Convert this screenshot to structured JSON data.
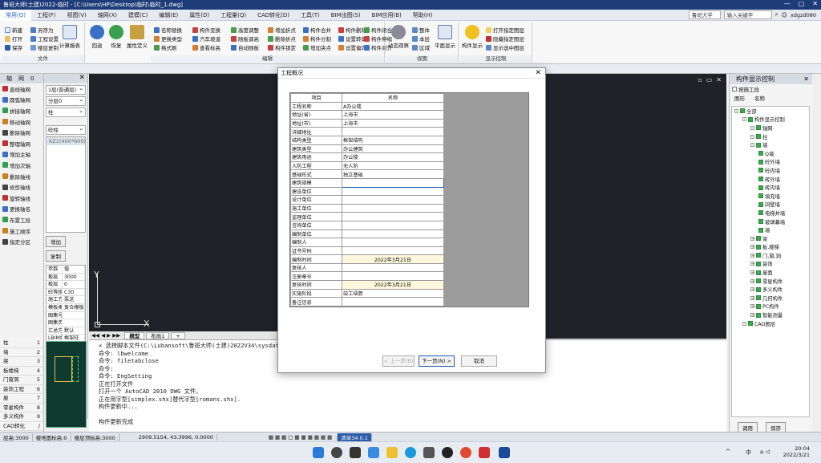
{
  "titlebar": {
    "text": "鲁班大师(土建)2022-临时 - [C:\\Users\\HP\\Desktop\\临时\\临时_1.dwg]"
  },
  "menu": {
    "items": [
      "常用(O)",
      "工程(F)",
      "视图(V)",
      "轴网(X)",
      "建模(C)",
      "编辑(E)",
      "属性(D)",
      "工程量(Q)",
      "CAD转化(D)",
      "工具(T)",
      "BIM出图(S)",
      "BIM应用(B)",
      "帮助(H)"
    ],
    "school": "鲁班大学",
    "search_placeholder": "输入关键字",
    "user": "xdgzd080"
  },
  "ribbon": {
    "file": {
      "title": "文件",
      "items": [
        "新建",
        "另存为",
        "打开",
        "工程设置",
        "保存",
        "楼层复制"
      ],
      "big": "计算报表"
    },
    "undo": [
      "回退",
      "恢复",
      "属性定义"
    ],
    "edit": {
      "title": "编辑",
      "items": [
        "名称替换",
        "构件变换",
        "高度调整",
        "增加折点",
        "构件合并",
        "构件删除",
        "构件闭合",
        "更换类型",
        "汽车坡道",
        "随板调高",
        "删除折点",
        "构件分割",
        "设置转角",
        "构件伸缩",
        "格式刷",
        "查看标高",
        "自动随板",
        "构件锁定",
        "增加夹点",
        "设置偏向",
        "构件对齐"
      ]
    },
    "view": {
      "title": "视图",
      "items": [
        "动态观察",
        "整体",
        "本层",
        "区域",
        "平面显示"
      ]
    },
    "display": {
      "title": "显示控制",
      "items": [
        "打开指定图层",
        "隐藏指定图层",
        "显示选中图层"
      ],
      "big": "构件显示"
    }
  },
  "leftpanel": {
    "header_a": "轴",
    "header_b": "网",
    "header_c": "0",
    "items": [
      "直线轴网",
      "圆弧轴网",
      "拼接轴网",
      "移动轴网",
      "删除轴网",
      "整理轴网",
      "增加主轴",
      "增加次轴",
      "删除轴线",
      "修剪轴线",
      "旋转轴线",
      "更换轴名",
      "布置工段",
      "施工顺序",
      "指定分区"
    ],
    "keys": [
      "0",
      "1",
      "2",
      "3",
      "4",
      "5",
      "6",
      "7",
      "8",
      "9",
      "0",
      "2"
    ]
  },
  "leftpanel2": {
    "floor": "1层(普通层)",
    "section": "分层0",
    "type": "柱",
    "subtype": "砼柱",
    "component": "KZ1(400*600)",
    "add_button": "增加",
    "copy_button": "复制",
    "props": [
      [
        "参数",
        "值"
      ],
      [
        "板层",
        "3000"
      ],
      [
        "板层",
        "0"
      ],
      [
        "砼等级",
        "C30"
      ],
      [
        "施工方式",
        "泵送"
      ],
      [
        "模板类型",
        "复合模板"
      ],
      [
        "图集号",
        ""
      ],
      [
        "图集页",
        ""
      ],
      [
        "汇总方式",
        "默认"
      ],
      [
        "LBIM编码",
        "框架柱"
      ]
    ]
  },
  "navlist": [
    [
      "柱",
      "1"
    ],
    [
      "墙",
      "2"
    ],
    [
      "梁",
      "3"
    ],
    [
      "板楼梯",
      "4"
    ],
    [
      "门窗洞",
      "5"
    ],
    [
      "装饰工程",
      "6"
    ],
    [
      "屋",
      "7"
    ],
    [
      "零星构件",
      "8"
    ],
    [
      "多义构件",
      "9"
    ],
    [
      "CAD转化",
      "/"
    ]
  ],
  "canvas": {
    "ylabel": "Y",
    "xlabel": "X",
    "tabs": [
      "模型",
      "布局1",
      "+"
    ]
  },
  "command": [
    "× 选择脚本文件(C:\\Lubansoft\\鲁班大师(土建)2022V34\\sysdata",
    "命令: lbwelcome",
    "命令: filetabclose",
    "命令:",
    "命令: EngSetting",
    "正在打开文件",
    "打开一个 AutoCAD 2010 DWG 文件。",
    "正在用字型[simplex.shx]替代字型[romans.shx].",
    "构件更新中...",
    "",
    "构件更新完成"
  ],
  "rightpanel": {
    "title": "构件显示控制",
    "checkbox": "按施工段",
    "col1": "图形",
    "col2": "名称",
    "tree": [
      [
        "全部",
        0,
        true
      ],
      [
        "构件显示控制",
        1,
        true
      ],
      [
        "轴网",
        2,
        true
      ],
      [
        "柱",
        2,
        true
      ],
      [
        "墙",
        2,
        true
      ],
      [
        "Q墙",
        3,
        true
      ],
      [
        "砼外墙",
        3,
        true
      ],
      [
        "砼内墙",
        3,
        true
      ],
      [
        "砖外墙",
        3,
        true
      ],
      [
        "砖内墙",
        3,
        true
      ],
      [
        "填充墙",
        3,
        true
      ],
      [
        "间壁墙",
        3,
        true
      ],
      [
        "电梯井墙",
        3,
        true
      ],
      [
        "玻璃幕墙",
        3,
        true
      ],
      [
        "墙",
        3,
        true
      ],
      [
        "梁",
        2,
        true
      ],
      [
        "板,楼梯",
        2,
        true
      ],
      [
        "门,窗,洞",
        2,
        true
      ],
      [
        "装饰",
        2,
        true
      ],
      [
        "屋面",
        2,
        true
      ],
      [
        "零星构件",
        2,
        true
      ],
      [
        "多义构件",
        2,
        true
      ],
      [
        "几何构件",
        2,
        true
      ],
      [
        "PC构件",
        2,
        true
      ],
      [
        "智能测量",
        2,
        true
      ],
      [
        "CAD图层",
        1,
        true
      ]
    ],
    "apply": "调用",
    "save": "保存"
  },
  "dialog": {
    "title": "工程概况",
    "head_key": "项目",
    "head_val": "名称",
    "rows": [
      [
        "工程名称",
        "A办公楼",
        ""
      ],
      [
        "地址(省)",
        "上海市",
        ""
      ],
      [
        "地址(市)",
        "上海市",
        ""
      ],
      [
        "详细地址",
        "",
        ""
      ],
      [
        "结构类型",
        "框架结构",
        ""
      ],
      [
        "建筑类型",
        "办公建筑",
        ""
      ],
      [
        "建筑用途",
        "办公楼",
        ""
      ],
      [
        "人防工程",
        "无人防",
        ""
      ],
      [
        "基础形式",
        "独立基础",
        ""
      ],
      [
        "建筑规模",
        "",
        "focus"
      ],
      [
        "建设单位",
        "",
        ""
      ],
      [
        "设计单位",
        "",
        ""
      ],
      [
        "施工单位",
        "",
        ""
      ],
      [
        "监理单位",
        "",
        ""
      ],
      [
        "咨询单位",
        "",
        ""
      ],
      [
        "编制单位",
        "",
        ""
      ],
      [
        "编制人",
        "",
        ""
      ],
      [
        "证书号码",
        "",
        ""
      ],
      [
        "编制时间",
        "2022年3月21日",
        "date"
      ],
      [
        "复核人",
        "",
        ""
      ],
      [
        "注册章号",
        "",
        ""
      ],
      [
        "复核时间",
        "2022年3月21日",
        "date"
      ],
      [
        "实施阶段",
        "竣工结算",
        ""
      ],
      [
        "备注信息",
        "",
        ""
      ]
    ],
    "prev": "< 上一步(B)",
    "next": "下一页(N) >",
    "cancel": "取消"
  },
  "status": [
    "层高:3000",
    "楼地面标高:0",
    "楼层顶标高:3000",
    "2909.5154, 43.3996, 0.0000",
    "清单34.0.1"
  ],
  "taskbar": {
    "time": "20:04",
    "date": "2022/3/21",
    "lang": "中"
  }
}
